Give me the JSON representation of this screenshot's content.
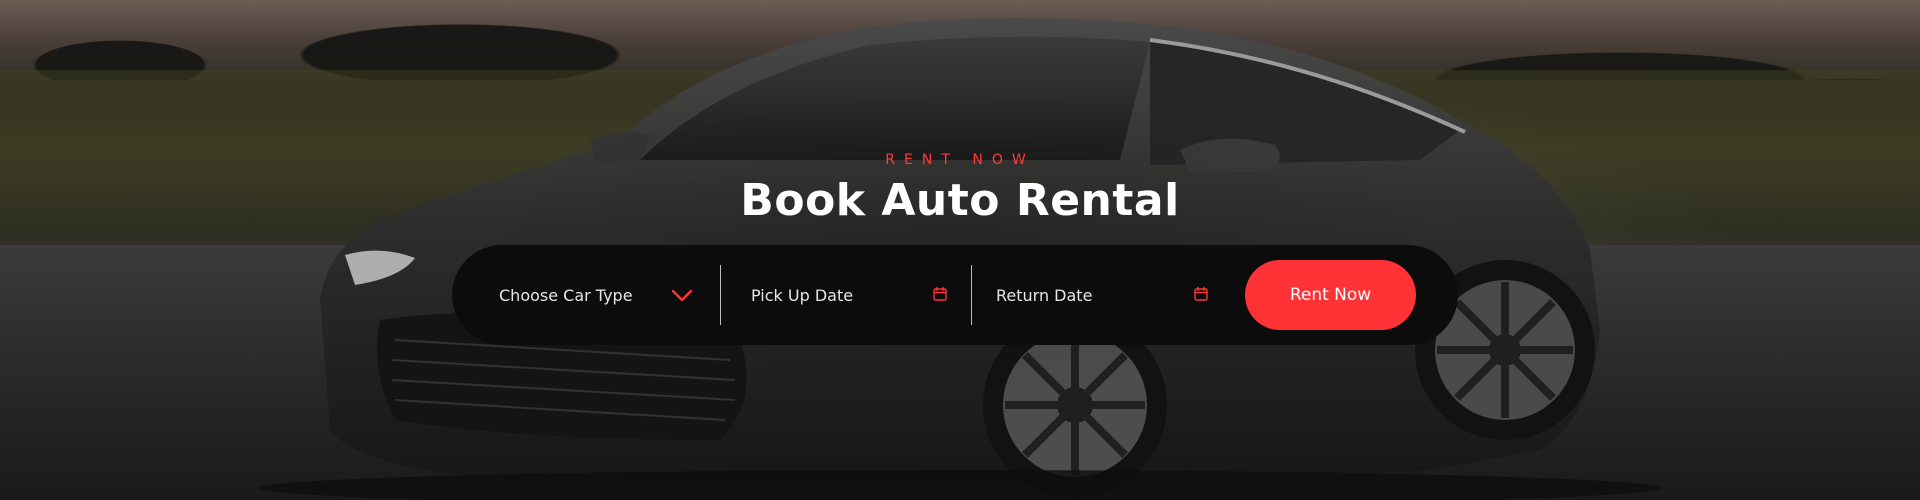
{
  "hero": {
    "eyebrow": "RENT NOW",
    "title": "Book Auto Rental"
  },
  "booking": {
    "car_type_label": "Choose Car Type",
    "pickup_label": "Pick Up Date",
    "return_label": "Return Date",
    "submit_label": "Rent Now"
  },
  "icons": {
    "car_type": "chevron-down-icon",
    "pickup": "calendar-icon",
    "return": "calendar-icon"
  },
  "colors": {
    "accent": "#ff3336",
    "bar_background": "#0c0c0c",
    "title": "#ffffff"
  }
}
